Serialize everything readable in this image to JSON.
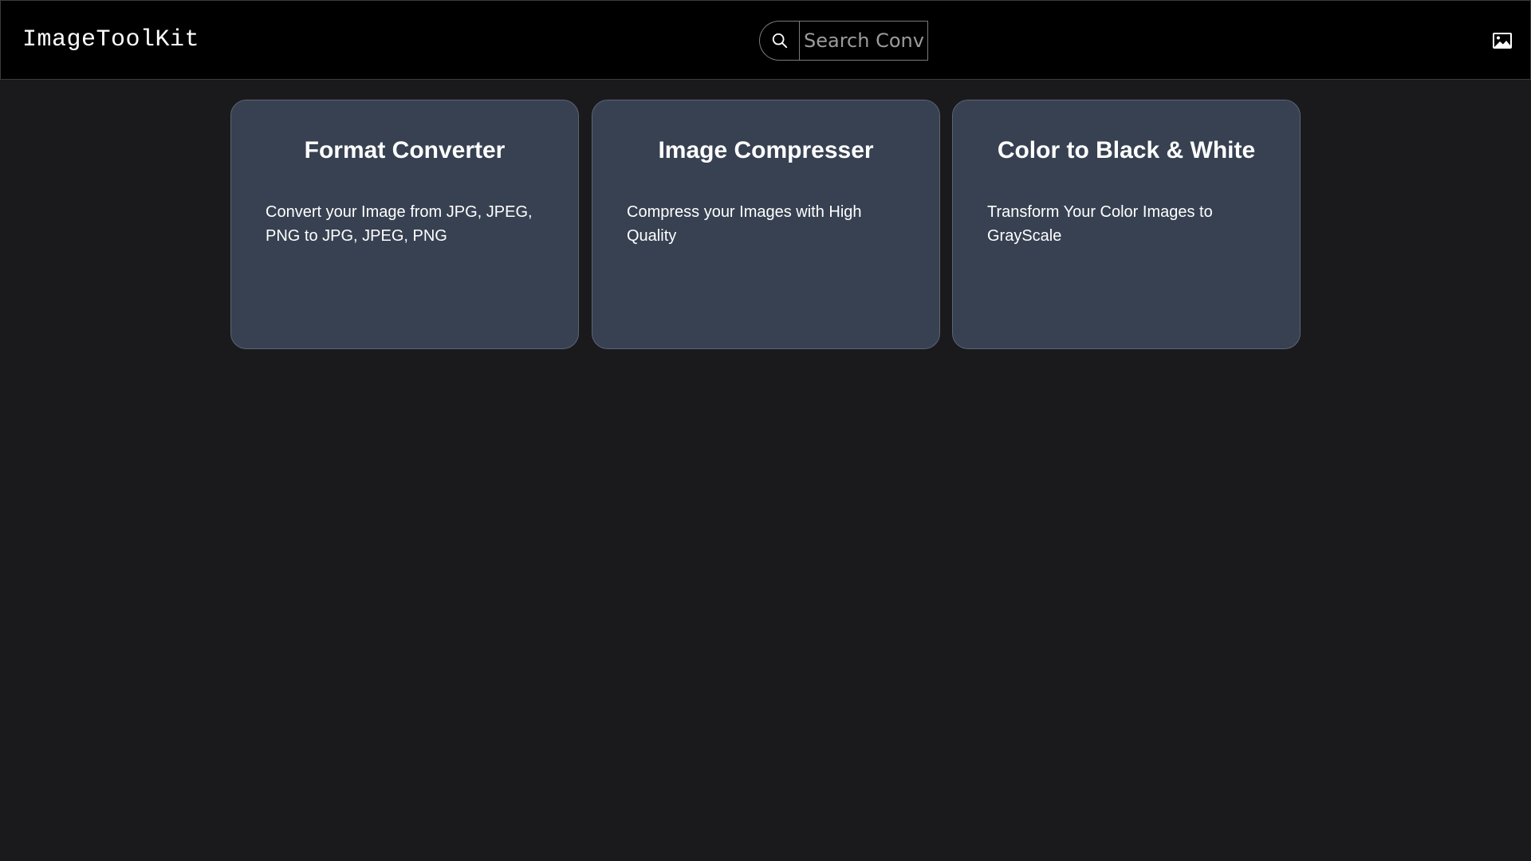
{
  "header": {
    "brand": "ImageToolKit",
    "search": {
      "placeholder": "Search Converter",
      "value": ""
    },
    "icons": {
      "search": "search-icon",
      "right": "image-icon"
    }
  },
  "cards": [
    {
      "title": "Format Converter",
      "description": "Convert your Image from JPG, JPEG, PNG to JPG, JPEG, PNG"
    },
    {
      "title": "Image Compresser",
      "description": "Compress your Images with High Quality"
    },
    {
      "title": "Color to Black & White",
      "description": "Transform Your Color Images to GrayScale"
    }
  ],
  "colors": {
    "page_background": "#1a1a1c",
    "header_background": "#000000",
    "card_background": "#374151",
    "text": "#ffffff"
  }
}
